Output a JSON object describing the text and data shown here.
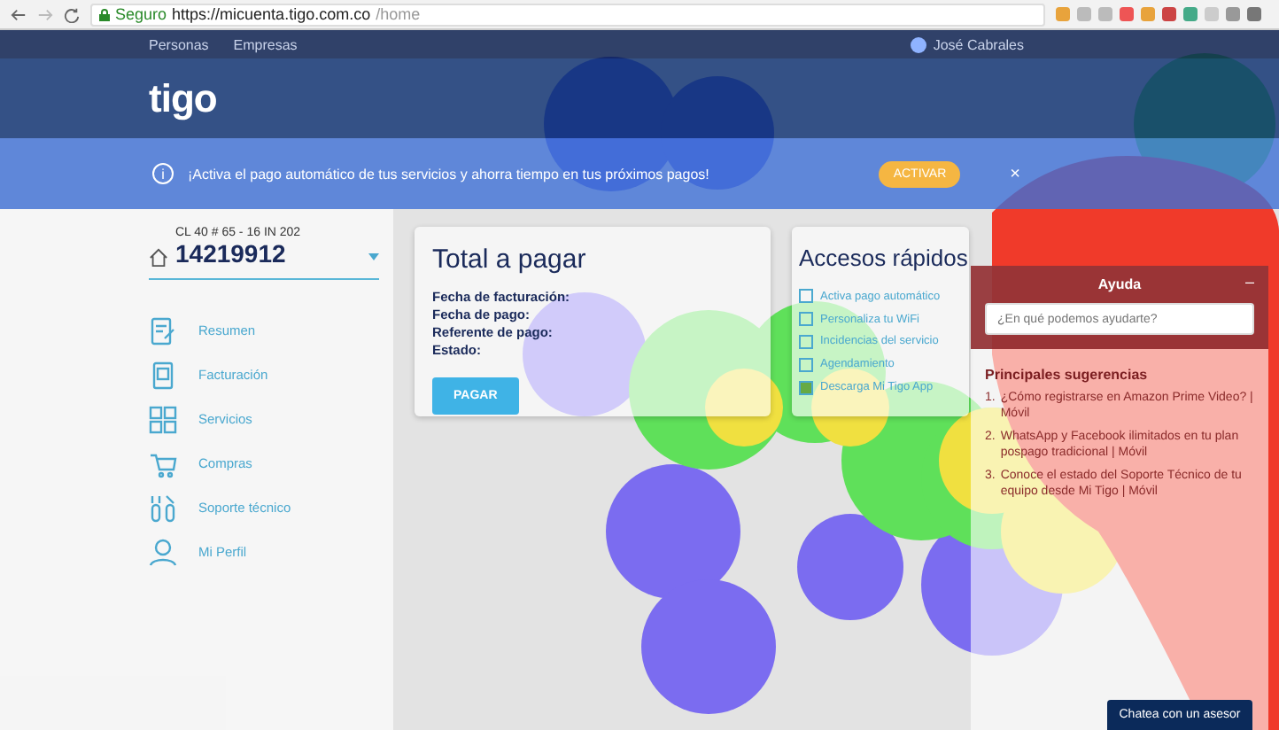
{
  "browser": {
    "secure_label": "Seguro",
    "url_host": "https://micuenta.tigo.com.co",
    "url_path": "/home"
  },
  "top_nav": {
    "links": [
      "Personas",
      "Empresas"
    ],
    "user": "José Cabrales"
  },
  "logo": "tigo",
  "banner": {
    "icon": "i",
    "text": "¡Activa el pago automático de tus servicios y ahorra tiempo en tus próximos pagos!",
    "button": "ACTIVAR",
    "close": "×"
  },
  "account": {
    "address": "CL 40 # 65 - 16 IN 202",
    "number": "14219912"
  },
  "sidebar": {
    "items": [
      {
        "label": "Resumen"
      },
      {
        "label": "Facturación"
      },
      {
        "label": "Servicios"
      },
      {
        "label": "Compras"
      },
      {
        "label": "Soporte técnico"
      },
      {
        "label": "Mi Perfil"
      }
    ]
  },
  "total_card": {
    "title": "Total a pagar",
    "fields": [
      "Fecha de facturación:",
      "Fecha de pago:",
      "Referente de pago:",
      "Estado:"
    ],
    "button": "PAGAR"
  },
  "quick_access": {
    "title": "Accesos rápidos",
    "items": [
      "Activa pago automático",
      "Personaliza tu WiFi",
      "Incidencias del servicio",
      "Agendamiento",
      "Descarga Mi Tigo App"
    ]
  },
  "help": {
    "title": "Ayuda",
    "minimize": "–",
    "placeholder": "¿En qué podemos ayudarte?",
    "heading": "Principales sugerencias",
    "suggestions": [
      {
        "number": "1.",
        "text": "¿Cómo registrarse en Amazon Prime Video? | Móvil"
      },
      {
        "number": "2.",
        "text": "WhatsApp y Facebook ilimitados en tu plan pospago tradicional | Móvil"
      },
      {
        "number": "3.",
        "text": "Conoce el estado del Soporte Técnico de tu equipo desde Mi Tigo | Móvil"
      }
    ]
  },
  "chat_button": "Chatea con un asesor"
}
